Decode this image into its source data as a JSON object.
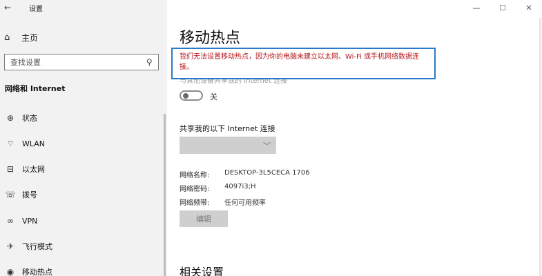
{
  "window": {
    "back_icon": "back-arrow-icon",
    "title": "设置",
    "controls": [
      "—",
      "☐",
      "✕"
    ]
  },
  "sidebar": {
    "home_label": "主页",
    "search_placeholder": "查找设置",
    "section_title": "网络和 Internet",
    "items": [
      {
        "label": "状态",
        "icon": "globe-icon"
      },
      {
        "label": "WLAN",
        "icon": "wifi-icon"
      },
      {
        "label": "以太网",
        "icon": "ethernet-icon"
      },
      {
        "label": "拨号",
        "icon": "dialup-icon"
      },
      {
        "label": "VPN",
        "icon": "vpn-icon"
      },
      {
        "label": "飞行模式",
        "icon": "airplane-icon"
      },
      {
        "label": "移动热点",
        "icon": "hotspot-icon"
      }
    ]
  },
  "main": {
    "title": "移动热点",
    "error_message": "我们无法设置移动热点，因为你的电脑未建立以太网、Wi-Fi 或手机网络数据连接。",
    "faded_text": "与其他设备共享我的 Internet 连接",
    "toggle_state": "关",
    "share_label": "共享我的以下 Internet 连接",
    "dropdown_value": "",
    "network_name_label": "网络名称:",
    "network_name_value": "DESKTOP-3L5CECA 1706",
    "network_password_label": "网络密码:",
    "network_password_value": "4097i3;H",
    "network_band_label": "网络频带:",
    "network_band_value": "任何可用频率",
    "edit_button": "编辑",
    "related_title": "相关设置"
  },
  "colors": {
    "sidebar_bg": "#f2f2f2",
    "error_text": "#b5161b",
    "banner_border": "#2a7ac7"
  }
}
